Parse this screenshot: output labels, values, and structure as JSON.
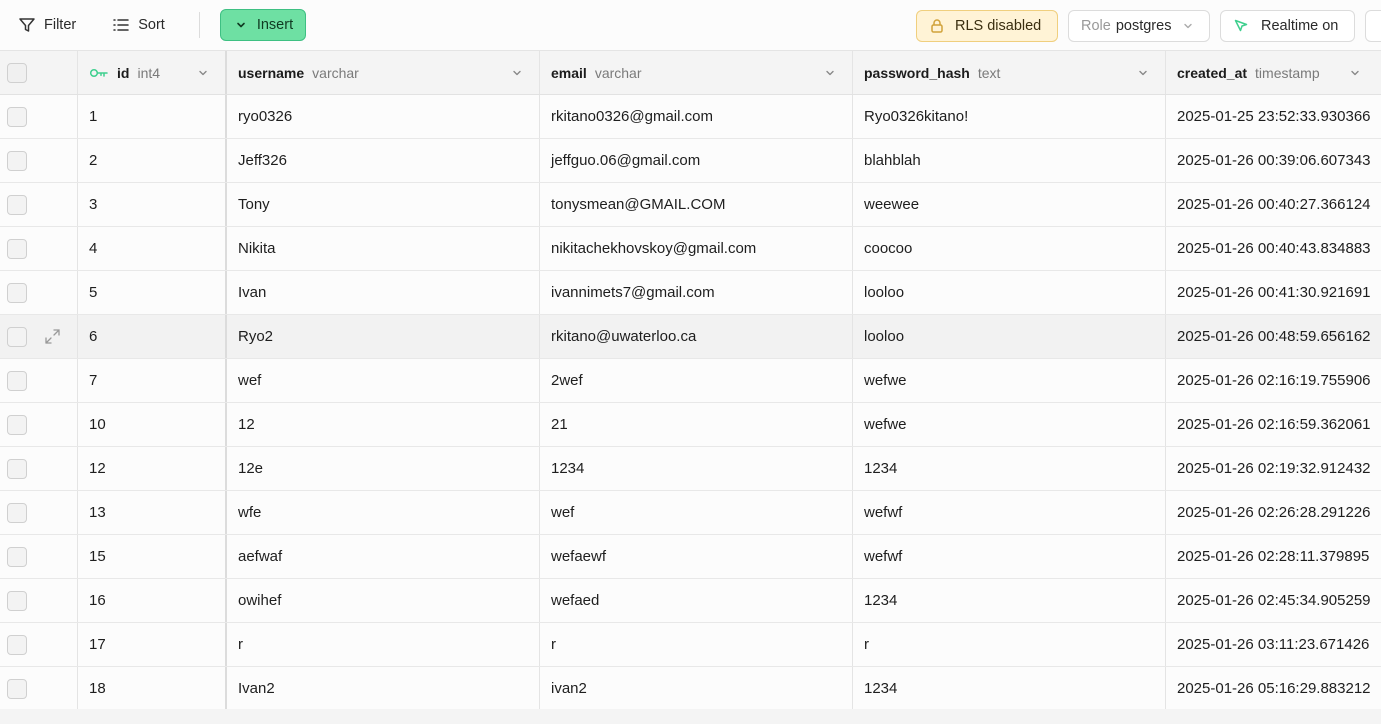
{
  "toolbar": {
    "filter_label": "Filter",
    "sort_label": "Sort",
    "insert_label": "Insert",
    "rls_label": "RLS disabled",
    "role_label": "Role",
    "role_value": "postgres",
    "realtime_label": "Realtime on"
  },
  "columns": [
    {
      "name": "id",
      "type": "int4",
      "primary_key": true
    },
    {
      "name": "username",
      "type": "varchar"
    },
    {
      "name": "email",
      "type": "varchar"
    },
    {
      "name": "password_hash",
      "type": "text"
    },
    {
      "name": "created_at",
      "type": "timestamp"
    }
  ],
  "rows": [
    {
      "id": "1",
      "username": "ryo0326",
      "email": "rkitano0326@gmail.com",
      "password_hash": "Ryo0326kitano!",
      "created_at": "2025-01-25 23:52:33.930366"
    },
    {
      "id": "2",
      "username": "Jeff326",
      "email": "jeffguo.06@gmail.com",
      "password_hash": "blahblah",
      "created_at": "2025-01-26 00:39:06.607343"
    },
    {
      "id": "3",
      "username": "Tony",
      "email": "tonysmean@GMAIL.COM",
      "password_hash": "weewee",
      "created_at": "2025-01-26 00:40:27.366124"
    },
    {
      "id": "4",
      "username": "Nikita",
      "email": "nikitachekhovskoy@gmail.com",
      "password_hash": "coocoo",
      "created_at": "2025-01-26 00:40:43.834883"
    },
    {
      "id": "5",
      "username": "Ivan",
      "email": "ivannimets7@gmail.com",
      "password_hash": "looloo",
      "created_at": "2025-01-26 00:41:30.921691"
    },
    {
      "id": "6",
      "username": "Ryo2",
      "email": "rkitano@uwaterloo.ca",
      "password_hash": "looloo",
      "created_at": "2025-01-26 00:48:59.656162"
    },
    {
      "id": "7",
      "username": "wef",
      "email": "2wef",
      "password_hash": "wefwe",
      "created_at": "2025-01-26 02:16:19.755906"
    },
    {
      "id": "10",
      "username": "12",
      "email": "21",
      "password_hash": "wefwe",
      "created_at": "2025-01-26 02:16:59.362061"
    },
    {
      "id": "12",
      "username": "12e",
      "email": "1234",
      "password_hash": "1234",
      "created_at": "2025-01-26 02:19:32.912432"
    },
    {
      "id": "13",
      "username": "wfe",
      "email": "wef",
      "password_hash": "wefwf",
      "created_at": "2025-01-26 02:26:28.291226"
    },
    {
      "id": "15",
      "username": "aefwaf",
      "email": "wefaewf",
      "password_hash": "wefwf",
      "created_at": "2025-01-26 02:28:11.379895"
    },
    {
      "id": "16",
      "username": "owihef",
      "email": "wefaed",
      "password_hash": "1234",
      "created_at": "2025-01-26 02:45:34.905259"
    },
    {
      "id": "17",
      "username": "r",
      "email": "r",
      "password_hash": "r",
      "created_at": "2025-01-26 03:11:23.671426"
    },
    {
      "id": "18",
      "username": "Ivan2",
      "email": "ivan2",
      "password_hash": "1234",
      "created_at": "2025-01-26 05:16:29.883212"
    }
  ],
  "hovered_row_index": 5,
  "colors": {
    "insert_bg": "#6ee0a3",
    "rls_bg": "#fff3d6",
    "key_icon": "#3ecf8e"
  }
}
